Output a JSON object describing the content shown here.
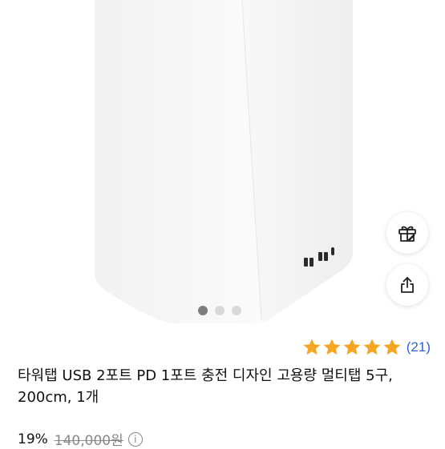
{
  "product": {
    "title": "타워탭 USB 2포트 PD 1포트 충전 디자인 고용량 멀티탭 5구, 200cm, 1개",
    "rating_stars": 5,
    "review_count": "(21)",
    "discount": "19%",
    "original_price": "140,000원"
  },
  "gallery": {
    "image_count": 3,
    "active_index": 0
  },
  "icons": {
    "gift": "gift-icon",
    "share": "share-icon",
    "info": "info-icon",
    "star": "star-icon"
  },
  "colors": {
    "star": "#f5a623",
    "review_link": "#2f64d8",
    "dot_active": "#7d7d7d",
    "dot_inactive": "#d9d9d9"
  }
}
